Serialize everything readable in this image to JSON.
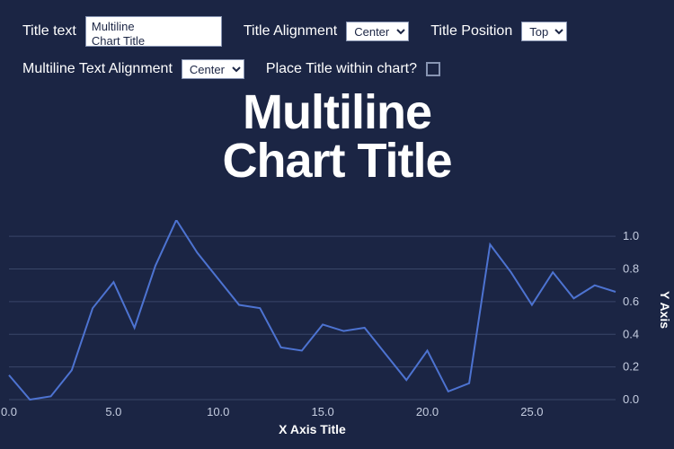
{
  "controls": {
    "title_text_label": "Title text",
    "title_text_value": "Multiline\nChart Title",
    "title_alignment_label": "Title Alignment",
    "title_alignment_value": "Center",
    "title_position_label": "Title Position",
    "title_position_value": "Top",
    "multiline_align_label": "Multiline Text Alignment",
    "multiline_align_value": "Center",
    "place_within_label": "Place Title within chart?",
    "place_within_checked": false
  },
  "chart_title": "Multiline\nChart Title",
  "chart_data": {
    "type": "line",
    "xlabel": "X Axis Title",
    "ylabel": "Y Axis",
    "xlim": [
      0,
      29
    ],
    "ylim": [
      0.0,
      1.1
    ],
    "x_ticks": [
      0.0,
      5.0,
      10.0,
      15.0,
      20.0,
      25.0
    ],
    "y_ticks": [
      0.0,
      0.2,
      0.4,
      0.6,
      0.8,
      1.0
    ],
    "x": [
      0,
      1,
      2,
      3,
      4,
      5,
      6,
      7,
      8,
      9,
      10,
      11,
      12,
      13,
      14,
      15,
      16,
      17,
      18,
      19,
      20,
      21,
      22,
      23,
      24,
      25,
      26,
      27,
      28,
      29
    ],
    "values": [
      0.15,
      0.0,
      0.02,
      0.18,
      0.56,
      0.72,
      0.44,
      0.82,
      1.1,
      0.9,
      0.74,
      0.58,
      0.56,
      0.32,
      0.3,
      0.46,
      0.42,
      0.44,
      0.28,
      0.12,
      0.3,
      0.05,
      0.1,
      0.95,
      0.78,
      0.58,
      0.78,
      0.62,
      0.7,
      0.66
    ]
  }
}
